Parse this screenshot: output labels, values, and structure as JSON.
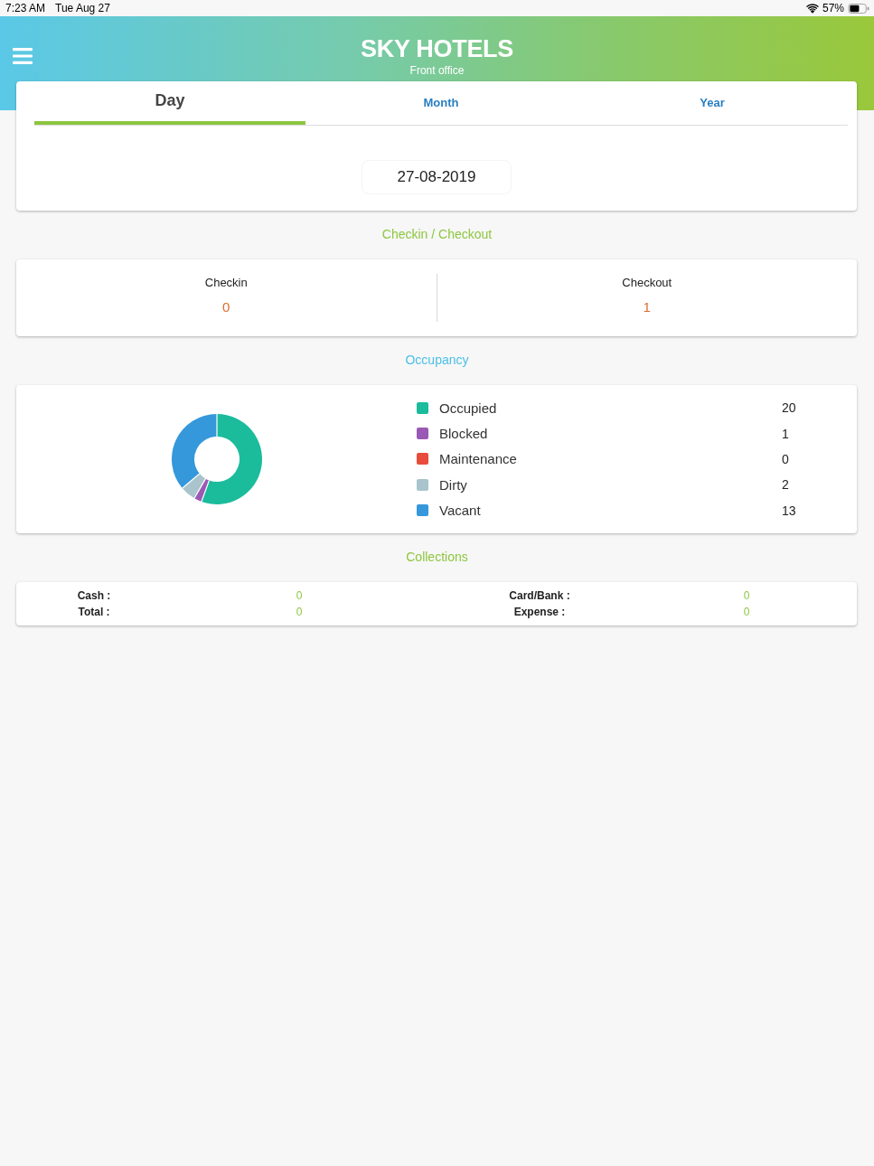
{
  "status_bar": {
    "time": "7:23 AM",
    "date": "Tue Aug 27",
    "battery": "57%"
  },
  "header": {
    "title": "SKY HOTELS",
    "subtitle": "Front office"
  },
  "tabs": [
    {
      "label": "Day",
      "selected": true
    },
    {
      "label": "Month",
      "selected": false
    },
    {
      "label": "Year",
      "selected": false
    }
  ],
  "date_field": {
    "value": "27-08-2019"
  },
  "checkin_checkout": {
    "title": "Checkin / Checkout",
    "items": [
      {
        "label": "Checkin",
        "value": "0"
      },
      {
        "label": "Checkout",
        "value": "1"
      }
    ]
  },
  "occupancy": {
    "title": "Occupancy",
    "chart_data": {
      "type": "donut",
      "categories": [
        "Occupied",
        "Blocked",
        "Maintenance",
        "Dirty",
        "Vacant"
      ],
      "values": [
        20,
        1,
        0,
        2,
        13
      ],
      "value_labels": [
        "20",
        "1",
        "0",
        "2",
        "13"
      ],
      "legend": "right"
    },
    "legend": [
      {
        "color": "#1abc9c"
      },
      {
        "color": "#9b59b6"
      },
      {
        "color": "#e74c3c"
      },
      {
        "color": "#a9c4cc"
      },
      {
        "color": "#3498db"
      }
    ]
  },
  "collections": {
    "title": "Collections",
    "items": [
      {
        "label": "Cash :",
        "value": "0"
      },
      {
        "label": "Card/Bank :",
        "value": "0"
      },
      {
        "label": "Total :",
        "value": "0"
      },
      {
        "label": "Expense :",
        "value": "0"
      }
    ]
  }
}
